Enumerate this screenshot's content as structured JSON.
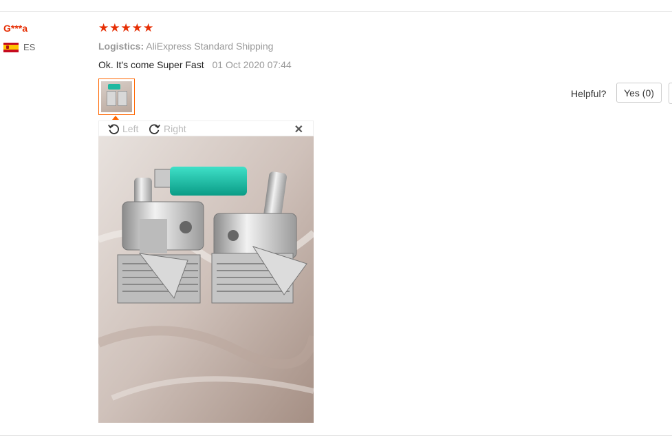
{
  "review": {
    "user_name": "G***a",
    "country_code": "ES",
    "rating": 5,
    "logistics_label": "Logistics:",
    "logistics_value": "AliExpress Standard Shipping",
    "text": "Ok. It's come Super Fast",
    "date": "01 Oct 2020 07:44",
    "helpful_label": "Helpful?",
    "yes_label": "Yes (0)"
  },
  "viewer": {
    "rotate_left": "Left",
    "rotate_right": "Right",
    "close_icon": "close-icon"
  },
  "colors": {
    "accent": "#e62e04",
    "thumb_border": "#ff6600",
    "muted": "#999999"
  }
}
